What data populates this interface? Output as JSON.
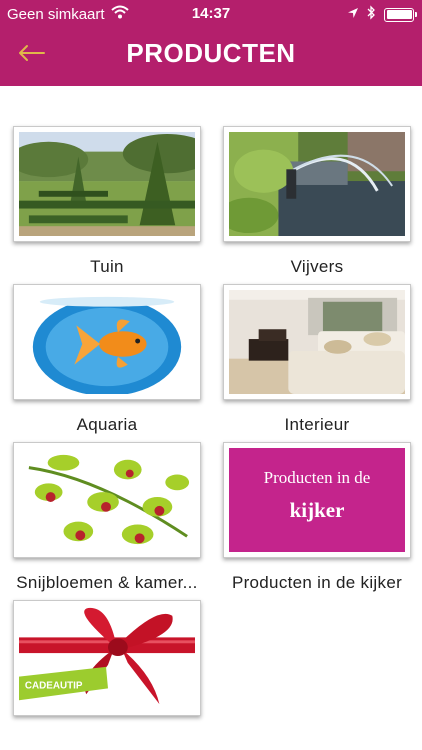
{
  "status_bar": {
    "carrier": "Geen simkaart",
    "time": "14:37"
  },
  "nav": {
    "title": "PRODUCTEN",
    "back_icon": "arrow-left-icon"
  },
  "colors": {
    "brand": "#b41f6c",
    "promo": "#c4248c"
  },
  "products": [
    {
      "label": "Tuin",
      "image": "garden-image"
    },
    {
      "label": "Vijvers",
      "image": "pond-image"
    },
    {
      "label": "Aquaria",
      "image": "goldfish-image"
    },
    {
      "label": "Interieur",
      "image": "living-room-image"
    },
    {
      "label": "Snijbloemen & kamer...",
      "image": "orchid-image"
    },
    {
      "label": "Producten in de kijker",
      "image": "promo-image"
    },
    {
      "label": "",
      "image": "gift-bow-image"
    }
  ],
  "promo": {
    "line1": "Producten in de",
    "line2": "kijker"
  },
  "gift": {
    "tag": "CADEAUTIP"
  }
}
